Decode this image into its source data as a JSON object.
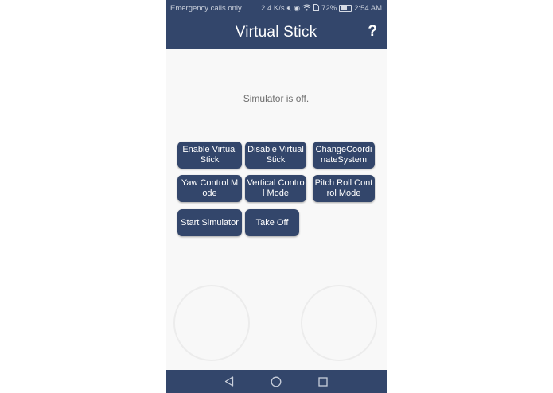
{
  "status_bar": {
    "carrier_text": "Emergency calls only",
    "speed": "2.4 K/s",
    "battery_percent": "72%",
    "time": "2:54 AM",
    "icons": [
      "mute-icon",
      "eye-icon",
      "wifi-icon",
      "sim-icon",
      "battery-icon"
    ]
  },
  "app_bar": {
    "title": "Virtual Stick",
    "help_label": "?"
  },
  "main": {
    "simulator_status": "Simulator is off.",
    "buttons": [
      {
        "label": "Enable Virtual Stick"
      },
      {
        "label": "Disable Virtual Stick"
      },
      {
        "label": "ChangeCoordinateSystem"
      },
      {
        "label": "Yaw Control Mode"
      },
      {
        "label": "Vertical Control Mode"
      },
      {
        "label": "Pitch Roll Control Mode"
      },
      {
        "label": "Start Simulator"
      },
      {
        "label": "Take Off"
      }
    ]
  },
  "nav_bar": {
    "icons": [
      "back-icon",
      "home-icon",
      "recents-icon"
    ]
  },
  "colors": {
    "primary": "#33466b",
    "background": "#f8f8f8",
    "status_text": "#6f6f6f"
  }
}
